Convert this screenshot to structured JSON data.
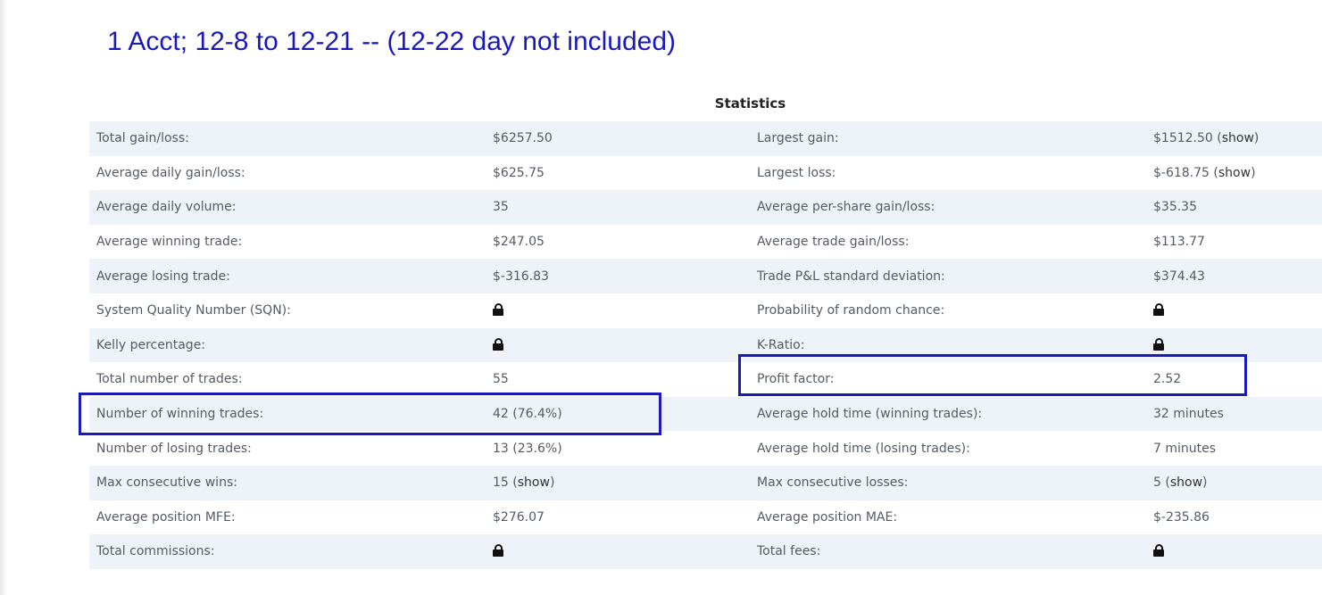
{
  "annotation": {
    "title": "1 Acct; 12-8 to 12-21 -- (12-22 day not included)",
    "color": "#1a1ab8"
  },
  "statistics": {
    "heading": "Statistics",
    "rows": [
      {
        "l1": "Total gain/loss:",
        "v1": "$6257.50",
        "l2": "Largest gain:",
        "v2": "$1512.50",
        "v2_link": "show"
      },
      {
        "l1": "Average daily gain/loss:",
        "v1": "$625.75",
        "l2": "Largest loss:",
        "v2": "$-618.75",
        "v2_link": "show"
      },
      {
        "l1": "Average daily volume:",
        "v1": "35",
        "l2": "Average per-share gain/loss:",
        "v2": "$35.35"
      },
      {
        "l1": "Average winning trade:",
        "v1": "$247.05",
        "l2": "Average trade gain/loss:",
        "v2": "$113.77"
      },
      {
        "l1": "Average losing trade:",
        "v1": "$-316.83",
        "l2": "Trade P&L standard deviation:",
        "v2": "$374.43"
      },
      {
        "l1": "System Quality Number (SQN):",
        "v1_icon": "lock-icon",
        "l2": "Probability of random chance:",
        "v2_icon": "lock-icon"
      },
      {
        "l1": "Kelly percentage:",
        "v1_icon": "lock-icon",
        "l2": "K-Ratio:",
        "v2_icon": "lock-icon"
      },
      {
        "l1": "Total number of trades:",
        "v1": "55",
        "l2": "Profit factor:",
        "v2": "2.52"
      },
      {
        "l1": "Number of winning trades:",
        "v1": "42 (76.4%)",
        "l2": "Average hold time (winning trades):",
        "v2": "32 minutes"
      },
      {
        "l1": "Number of losing trades:",
        "v1": "13 (23.6%)",
        "l2": "Average hold time (losing trades):",
        "v2": "7 minutes"
      },
      {
        "l1": "Max consecutive wins:",
        "v1": "15",
        "v1_link": "show",
        "l2": "Max consecutive losses:",
        "v2": "5",
        "v2_link": "show"
      },
      {
        "l1": "Average position MFE:",
        "v1": "$276.07",
        "l2": "Average position MAE:",
        "v2": "$-235.86"
      },
      {
        "l1": "Total commissions:",
        "v1_icon": "lock-icon",
        "l2": "Total fees:",
        "v2_icon": "lock-icon"
      }
    ]
  }
}
